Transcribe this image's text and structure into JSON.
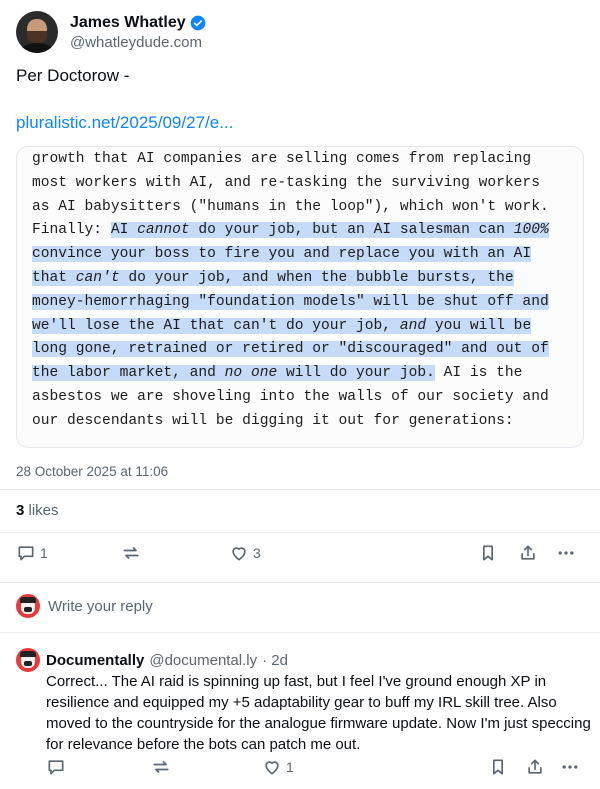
{
  "post": {
    "author": {
      "name": "James Whatley",
      "handle": "@whatleydude.com",
      "verified_color": "#1083fe"
    },
    "text": "Per Doctorow -",
    "link": "pluralistic.net/2025/09/27/e...",
    "quote_lines": [
      [
        {
          "t": "growth that AI companies are selling comes from replacing"
        }
      ],
      [
        {
          "t": "most workers with AI, and re-tasking the surviving workers"
        }
      ],
      [
        {
          "t": "as AI babysitters (\"humans in the loop\"), which won't work."
        }
      ],
      [
        {
          "t": "Finally: "
        },
        {
          "t": "AI ",
          "h": true
        },
        {
          "t": "cannot",
          "h": true,
          "i": true
        },
        {
          "t": " do your job, but an AI salesman can ",
          "h": true
        },
        {
          "t": "100%",
          "h": true,
          "i": true
        }
      ],
      [
        {
          "t": "convince your boss to fire you and replace you with an AI",
          "h": true
        }
      ],
      [
        {
          "t": "that ",
          "h": true
        },
        {
          "t": "can't",
          "h": true,
          "i": true
        },
        {
          "t": " do your job, and when the bubble bursts, the",
          "h": true
        }
      ],
      [
        {
          "t": "money-hemorrhaging \"foundation models\" will be shut off and",
          "h": true
        }
      ],
      [
        {
          "t": "we'll lose the AI that can't do your job, ",
          "h": true
        },
        {
          "t": "and",
          "h": true,
          "i": true
        },
        {
          "t": " you will be",
          "h": true
        }
      ],
      [
        {
          "t": "long gone, retrained or retired or \"discouraged\" and out of",
          "h": true
        }
      ],
      [
        {
          "t": "the labor market, and ",
          "h": true
        },
        {
          "t": "no one",
          "h": true,
          "i": true
        },
        {
          "t": " will do your job.",
          "h": true
        },
        {
          "t": " AI is the"
        }
      ],
      [
        {
          "t": "asbestos we are shoveling into the walls of our society and"
        }
      ],
      [
        {
          "t": "our descendants will be digging it out for generations:"
        }
      ]
    ],
    "timestamp": "28 October 2025 at 11:06",
    "likes_count": "3",
    "likes_label": " likes",
    "actions": {
      "reply_count": "1",
      "like_count": "3"
    }
  },
  "reply_box": {
    "placeholder": "Write your reply"
  },
  "reply": {
    "author": "Documentally",
    "handle": "@documental.ly",
    "age": "· 2d",
    "text": "Correct... The AI raid is spinning up fast, but I feel I've ground enough XP in resilience and equipped my +5 adaptability gear to buff my IRL skill tree. Also moved to the countryside for the analogue firmware update. Now I'm just speccing for relevance before the bots can patch me out.",
    "actions": {
      "like_count": "1"
    }
  },
  "colors": {
    "accent": "#1083fe",
    "highlight": "#c6dbf8",
    "muted": "#5b6670"
  },
  "icons": [
    "verified-badge-icon",
    "reply-icon",
    "repost-icon",
    "like-icon",
    "bookmark-icon",
    "share-icon",
    "more-icon"
  ]
}
